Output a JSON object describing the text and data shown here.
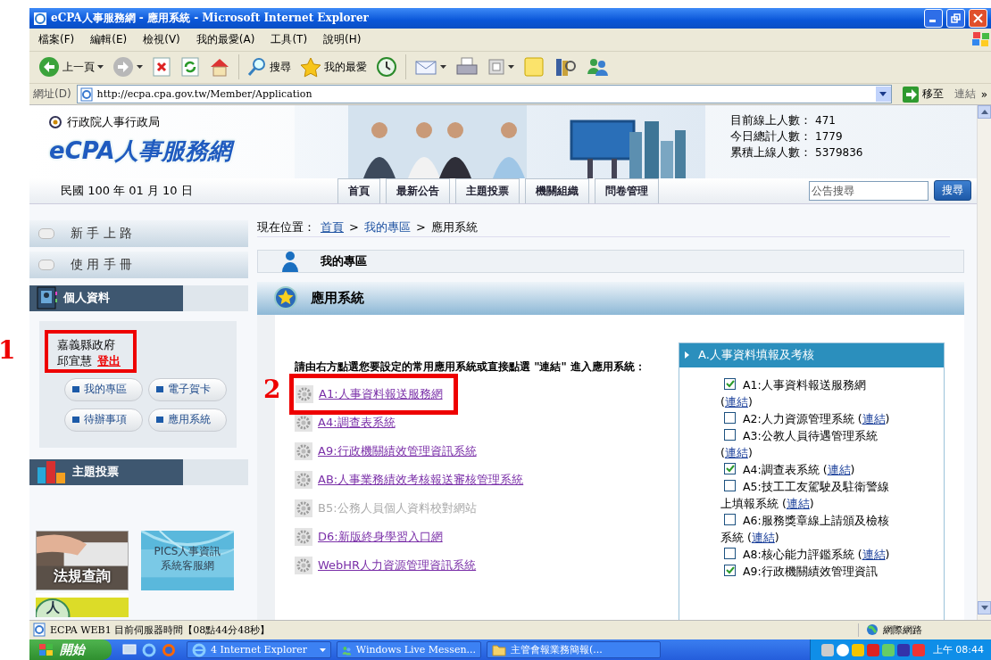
{
  "window": {
    "title": "eCPA人事服務網 - 應用系統 - Microsoft Internet Explorer"
  },
  "menu": [
    "檔案(F)",
    "編輯(E)",
    "檢視(V)",
    "我的最愛(A)",
    "工具(T)",
    "說明(H)"
  ],
  "toolbar": [
    {
      "kind": "back",
      "label": "上一頁"
    },
    {
      "kind": "forward"
    },
    {
      "kind": "stop"
    },
    {
      "kind": "refresh"
    },
    {
      "kind": "home"
    },
    {
      "kind": "search",
      "label": "搜尋"
    },
    {
      "kind": "favorites",
      "label": "我的最愛"
    },
    {
      "kind": "history"
    },
    {
      "kind": "mail"
    },
    {
      "kind": "print"
    },
    {
      "kind": "edit"
    },
    {
      "kind": "note"
    },
    {
      "kind": "research"
    },
    {
      "kind": "messenger"
    }
  ],
  "address": {
    "label": "網址(D)",
    "url": "http://ecpa.cpa.gov.tw/Member/Application",
    "go": "移至",
    "links": "連結",
    "more": "»"
  },
  "site": {
    "agency": "行政院人事行政局",
    "logo": "eCPA人事服務網",
    "stats": [
      {
        "label": "目前線上人數：",
        "value": "471"
      },
      {
        "label": "今日總計人數：",
        "value": "1779"
      },
      {
        "label": "累積上線人數：",
        "value": "5379836"
      }
    ],
    "date": "民國 100 年 01 月 10 日",
    "tabs": [
      "首頁",
      "最新公告",
      "主題投票",
      "機關組織",
      "問卷管理"
    ],
    "search": {
      "placeholder": "公告搜尋",
      "button": "搜尋"
    }
  },
  "sidebar": {
    "links": [
      "新 手 上 路",
      "使 用 手 冊"
    ],
    "profile": {
      "title": "個人資料",
      "org": "嘉義縣政府",
      "name": "邱宜慧",
      "logout": "登出",
      "callout": "1"
    },
    "profile_buttons": [
      "我的專區",
      "電子賀卡",
      "待辦事項",
      "應用系統"
    ],
    "vote_title": "主題投票",
    "banners": [
      {
        "lines": [
          "法規查詢"
        ]
      },
      {
        "kind": "tile",
        "lines": [
          "PICS人事資訊",
          "系統客服網"
        ]
      },
      {
        "kind": "badge",
        "lines": [
          "人"
        ]
      }
    ]
  },
  "main": {
    "breadcrumb": {
      "label": "現在位置：",
      "items": [
        {
          "kind": "link",
          "text": "首頁"
        },
        {
          "kind": "link",
          "sep": ">",
          "text": "我的專區"
        },
        {
          "kind": "current",
          "sep": ">",
          "text": "應用系統"
        }
      ]
    },
    "section": "我的專區",
    "panel_title": "應用系統",
    "instruction": "請由右方點選您要設定的常用應用系統或直接點選 \"連結\" 進入應用系統：",
    "apps": [
      {
        "text": "A1:人事資料報送服務網",
        "disabled": false,
        "callout": "2"
      },
      {
        "text": "A4:調查表系統",
        "disabled": false
      },
      {
        "text": "A9:行政機關績效管理資訊系統",
        "disabled": false
      },
      {
        "text": "AB:人事業務績效考核報送審核管理系統",
        "disabled": false
      },
      {
        "text": "B5:公務人員個人資料校對網站",
        "disabled": true
      },
      {
        "text": "D6:新版終身學習入口網",
        "disabled": false
      },
      {
        "text": "WebHR人力資源管理資訊系統",
        "disabled": false
      }
    ],
    "category": {
      "title": "A.人事資料填報及考核",
      "items": [
        {
          "checked": true,
          "label": "A1:人事資料報送服務網 (",
          "link": "連結",
          "after": ")"
        },
        {
          "checked": false,
          "label": "A2:人力資源管理系統 (",
          "link": "連結",
          "after": ")"
        },
        {
          "checked": false,
          "label": "A3:公教人員待遇管理系統 (",
          "link": "連結",
          "after": ")"
        },
        {
          "checked": true,
          "label": "A4:調查表系統 (",
          "link": "連結",
          "after": ")"
        },
        {
          "checked": false,
          "label": "A5:技工工友駕駛及駐衛警線上填報系統 (",
          "link": "連結",
          "after": ")"
        },
        {
          "checked": false,
          "label": "A6:服務獎章線上請頒及檢核系統 (",
          "link": "連結",
          "after": ")"
        },
        {
          "checked": false,
          "label": "A8:核心能力評鑑系統 (",
          "link": "連結",
          "after": ")"
        },
        {
          "checked": true,
          "label": "A9:行政機關績效管理資訊"
        }
      ]
    }
  },
  "status": {
    "text": "ECPA WEB1 目前伺服器時間【08點44分48秒】",
    "zone": "網際網路"
  },
  "taskbar": {
    "start": "開始",
    "tasks": [
      {
        "kind": "ie",
        "label": "4 Internet Explorer"
      },
      {
        "kind": "messenger",
        "label": "Windows Live Messen..."
      },
      {
        "kind": "folder",
        "label": "主管會報業務簡報(..."
      }
    ],
    "clock": "上午 08:44"
  }
}
